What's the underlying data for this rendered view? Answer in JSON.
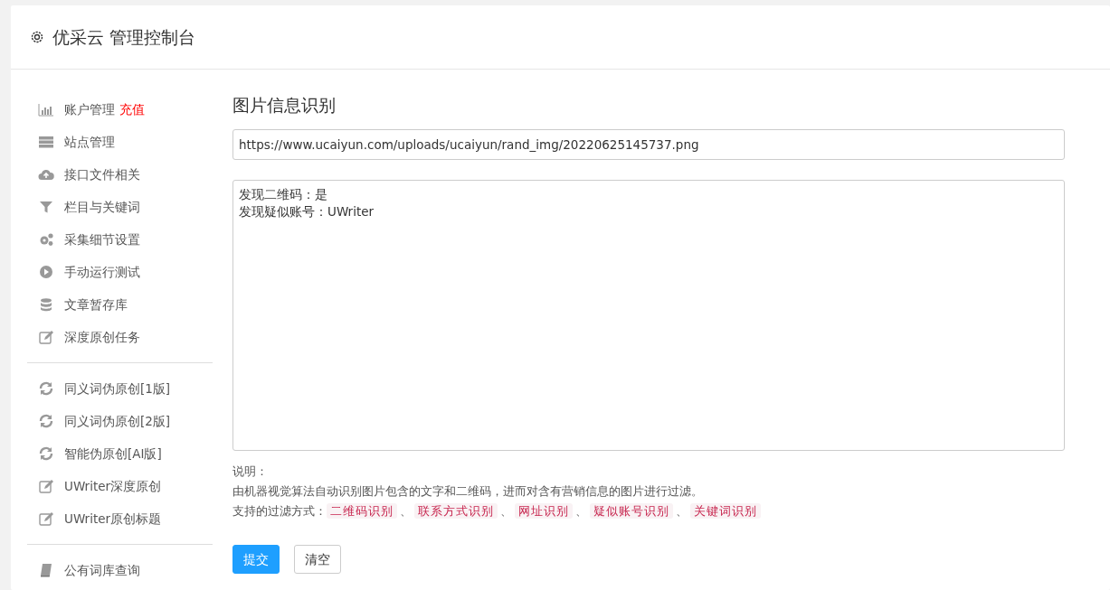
{
  "header": {
    "title": "优采云 管理控制台"
  },
  "sidebar": {
    "groups": [
      [
        {
          "label": "账户管理",
          "badge": "充值",
          "selected": false
        },
        {
          "label": "站点管理",
          "selected": false
        },
        {
          "label": "接口文件相关",
          "selected": false
        },
        {
          "label": "栏目与关键词",
          "selected": false
        },
        {
          "label": "采集细节设置",
          "selected": false
        },
        {
          "label": "手动运行测试",
          "selected": false
        },
        {
          "label": "文章暂存库",
          "selected": false
        },
        {
          "label": "深度原创任务",
          "selected": false
        }
      ],
      [
        {
          "label": "同义词伪原创[1版]",
          "selected": false
        },
        {
          "label": "同义词伪原创[2版]",
          "selected": false
        },
        {
          "label": "智能伪原创[AI版]",
          "selected": false
        },
        {
          "label": "UWriter深度原创",
          "selected": false
        },
        {
          "label": "UWriter原创标题",
          "selected": false
        }
      ],
      [
        {
          "label": "公有词库查询",
          "selected": false
        }
      ]
    ]
  },
  "main": {
    "heading": "图片信息识别",
    "url_field": {
      "value": "https://www.ucaiyun.com/uploads/ucaiyun/rand_img/20220625145737.png"
    },
    "result_area": {
      "lines": [
        "发现二维码：是",
        "发现疑似账号：UWriter"
      ]
    },
    "notes": {
      "title": "说明：",
      "description": "由机器视觉算法自动识别图片包含的文字和二维码，进而对含有营销信息的图片进行过滤。",
      "methods_label": "支持的过滤方式：",
      "separator": "、",
      "methods": [
        "二维码识别",
        "联系方式识别",
        "网址识别",
        "疑似账号识别",
        "关键词识别"
      ]
    },
    "buttons": [
      {
        "label": "提交",
        "kind": "primary"
      },
      {
        "label": "清空",
        "kind": "secondary"
      }
    ]
  }
}
